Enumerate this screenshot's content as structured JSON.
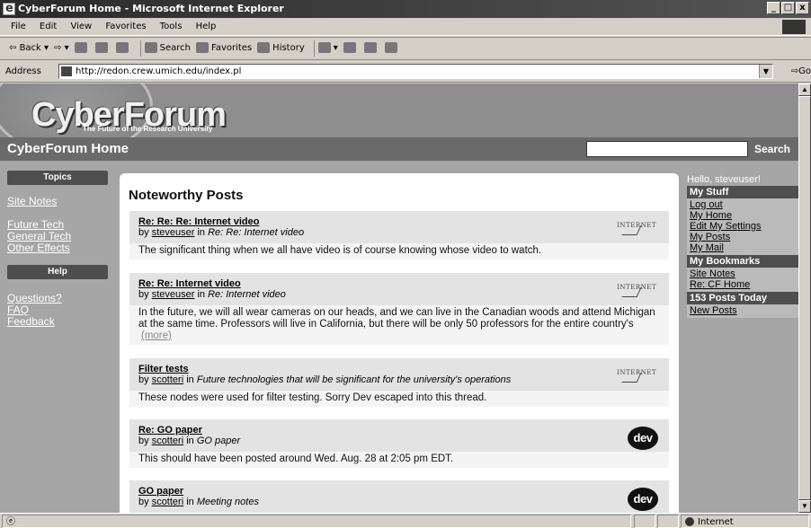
{
  "window": {
    "title": "CyberForum Home - Microsoft Internet Explorer"
  },
  "menu": [
    "File",
    "Edit",
    "View",
    "Favorites",
    "Tools",
    "Help"
  ],
  "toolbar": {
    "back": "Back",
    "forward": "",
    "search": "Search",
    "favorites": "Favorites",
    "history": "History"
  },
  "address": {
    "label": "Address",
    "url": "http://redon.crew.umich.edu/index.pl",
    "go": "Go"
  },
  "site": {
    "logo": "CyberForum",
    "tagline": "The Future of the Research University",
    "page_title": "CyberForum Home",
    "search_button": "Search"
  },
  "left_nav": {
    "topics_heading": "Topics",
    "topics": [
      "Site Notes",
      "Future Tech",
      "General Tech",
      "Other Effects"
    ],
    "help_heading": "Help",
    "help": [
      "Questions?",
      "FAQ",
      "Feedback"
    ]
  },
  "main": {
    "title": "Noteworthy Posts",
    "posts": [
      {
        "title": "Re: Re: Re: Internet video",
        "by": "by",
        "author": "steveuser",
        "in": "in",
        "forum": "Re: Re: Internet video",
        "body": "The significant thing when we all have video is of course knowing whose video to watch.",
        "more": "",
        "logo": "internet-logo"
      },
      {
        "title": "Re: Re: Internet video",
        "by": "by",
        "author": "steveuser",
        "in": "in",
        "forum": "Re: Internet video",
        "body": "In the future, we will all wear cameras on our heads, and we can live in the Canadian woods and attend Michigan at the same time. Professors will live in California, but there will be only 50 professors for the entire country's",
        "more": "(more)",
        "logo": "internet-logo"
      },
      {
        "title": "Filter tests",
        "by": "by",
        "author": "scotteri",
        "in": "in",
        "forum": "Future technologies that will be significant for the university's operations",
        "body": "These nodes were used for filter testing. Sorry Dev escaped into this thread.",
        "more": "",
        "logo": "internet-logo"
      },
      {
        "title": "Re: GO paper",
        "by": "by",
        "author": "scotteri",
        "in": "in",
        "forum": "GO paper",
        "body": "This should have been posted around Wed. Aug. 28 at 2:05 pm EDT.",
        "more": "",
        "logo": "dev-logo"
      },
      {
        "title": "GO paper",
        "by": "by",
        "author": "scotteri",
        "in": "in",
        "forum": "Meeting notes",
        "body": "",
        "more": "",
        "logo": "dev-logo"
      }
    ],
    "dev_logo_text": "dev",
    "internet_logo_text": "INTERNET"
  },
  "right_nav": {
    "greeting": "Hello, steveuser!",
    "my_stuff_heading": "My Stuff",
    "my_stuff": [
      "Log out",
      "My Home",
      "Edit My Settings",
      "My Posts",
      "My Mail"
    ],
    "bookmarks_heading": "My Bookmarks",
    "bookmarks": [
      "Site Notes",
      "Re: CF Home"
    ],
    "posts_today_heading": "153 Posts Today",
    "posts_today": [
      "New Posts"
    ]
  },
  "status": {
    "zone": "Internet"
  }
}
